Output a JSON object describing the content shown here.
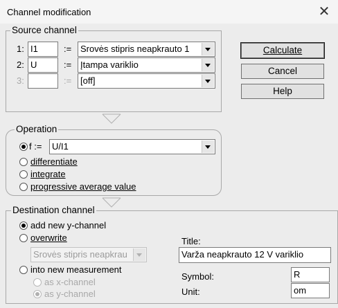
{
  "window": {
    "title": "Channel modification",
    "close_glyph": "✕"
  },
  "source": {
    "legend": "Source channel",
    "rows": [
      {
        "label": "1:",
        "var": "I1",
        "assign": ":=",
        "channel": "Srovės stipris neapkrauto 1",
        "enabled": true
      },
      {
        "label": "2:",
        "var": "U",
        "assign": ":=",
        "channel": "Įtampa variklio",
        "enabled": true
      },
      {
        "label": "3:",
        "var": "",
        "assign": ":=",
        "channel": "[off]",
        "enabled": false
      }
    ]
  },
  "buttons": {
    "calculate": "Calculate",
    "cancel": "Cancel",
    "help": "Help"
  },
  "operation": {
    "legend": "Operation",
    "f_label": "f :=",
    "formula": "U/I1",
    "options": [
      {
        "label": "differentiate",
        "checked": false
      },
      {
        "label": "integrate",
        "checked": false
      },
      {
        "label": "progressive average value",
        "checked": false
      }
    ],
    "formula_checked": true
  },
  "destination": {
    "legend": "Destination channel",
    "add_new": {
      "label": "add new y-channel",
      "checked": true
    },
    "overwrite": {
      "label": "overwrite",
      "checked": false,
      "channel": "Srovės stipris neapkrau"
    },
    "into_new": {
      "label": "into new measurement",
      "checked": false
    },
    "as_x": {
      "label": "as x-channel",
      "checked": false
    },
    "as_y": {
      "label": "as y-channel",
      "checked": true
    },
    "title_label": "Title:",
    "title_value": "Varža neapkrauto 12 V variklio",
    "symbol_label": "Symbol:",
    "symbol_value": "R",
    "unit_label": "Unit:",
    "unit_value": "om"
  }
}
